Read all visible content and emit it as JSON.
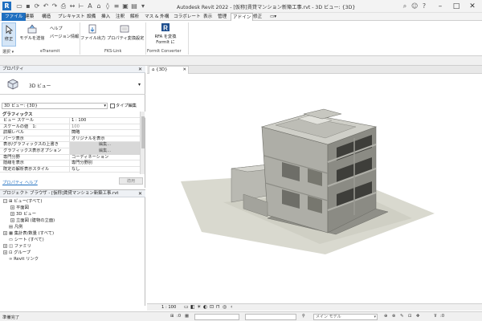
{
  "window": {
    "title": "Autodesk Revit 2022 - [仮称]賃貸マンション新築工事.rvt - 3D ビュー: {3D}",
    "app_letter": "R"
  },
  "menu_tabs": [
    {
      "label": "ファイル"
    },
    {
      "label": "建築"
    },
    {
      "label": "構造"
    },
    {
      "label": "プレキャスト"
    },
    {
      "label": "設備"
    },
    {
      "label": "挿入"
    },
    {
      "label": "注釈"
    },
    {
      "label": "解析"
    },
    {
      "label": "マス & 外構"
    },
    {
      "label": "コラボレート"
    },
    {
      "label": "表示"
    },
    {
      "label": "管理"
    },
    {
      "label": "アドイン"
    },
    {
      "label": "修正"
    }
  ],
  "ribbon": {
    "modify_label": "修正",
    "model_send_label": "モデルを送信",
    "help_label": "ヘルプ",
    "version_info_label": "バージョン情報",
    "file_output_label": "ファイル出力",
    "property_convert_label": "プロパティ変換設定",
    "rfa_convert_label": "RFA を変換",
    "formit_label": "FormIt に",
    "select_label": "選択",
    "panels": {
      "etransmit": "eTransmit",
      "fks_link": "FKS-Link",
      "formit_converter": "FormIt Converter"
    }
  },
  "properties": {
    "header": "プロパティ",
    "type_name": "3D ビュー",
    "instance_select": "3D ビュー: {3D}",
    "edit_type_button": "タイプ編集",
    "group_graphics": "グラフィックス",
    "rows": [
      {
        "key": "ビュー スケール",
        "value": "1 : 100",
        "style": ""
      },
      {
        "key": "スケールの値　1:",
        "value": "100",
        "style": "dim"
      },
      {
        "key": "詳細レベル",
        "value": "簡略",
        "style": ""
      },
      {
        "key": "パーツ表示",
        "value": "オリジナルを表示",
        "style": ""
      },
      {
        "key": "表示/グラフィックスの上書き",
        "value": "編集...",
        "style": "grey"
      },
      {
        "key": "グラフィックス表示オプション",
        "value": "編集...",
        "style": "grey"
      },
      {
        "key": "専門分野",
        "value": "コーディネーション",
        "style": ""
      },
      {
        "key": "隠線を表示",
        "value": "専門分野別",
        "style": ""
      },
      {
        "key": "既定の解析表示スタイル",
        "value": "なし",
        "style": ""
      }
    ],
    "help_link": "プロパティ ヘルプ",
    "apply_button": "適用"
  },
  "browser": {
    "header": "プロジェクト ブラウザ - [仮称]賃貸マンション新築工事.rvt",
    "items": [
      {
        "label": "ビュー(すべて)",
        "exp": "−",
        "indent": 0
      },
      {
        "label": "平面図",
        "exp": "+",
        "indent": 1
      },
      {
        "label": "3D ビュー",
        "exp": "+",
        "indent": 1
      },
      {
        "label": "立面図 (建物の立面)",
        "exp": "+",
        "indent": 1
      },
      {
        "label": "凡例",
        "exp": "",
        "indent": 0
      },
      {
        "label": "集計表/数量 (すべて)",
        "exp": "+",
        "indent": 0
      },
      {
        "label": "シート (すべて)",
        "exp": "",
        "indent": 0
      },
      {
        "label": "ファミリ",
        "exp": "+",
        "indent": 0
      },
      {
        "label": "グループ",
        "exp": "+",
        "indent": 0
      },
      {
        "label": "Revit リンク",
        "exp": "",
        "indent": 0
      }
    ]
  },
  "view": {
    "tab_label": "{3D}",
    "scale": "1 : 100"
  },
  "status": {
    "ready": "準備完了",
    "zero": ":0",
    "model": "メイン モデル"
  },
  "colors": {
    "accent": "#1f6fc0",
    "file_tab": "#1f6fc0"
  }
}
